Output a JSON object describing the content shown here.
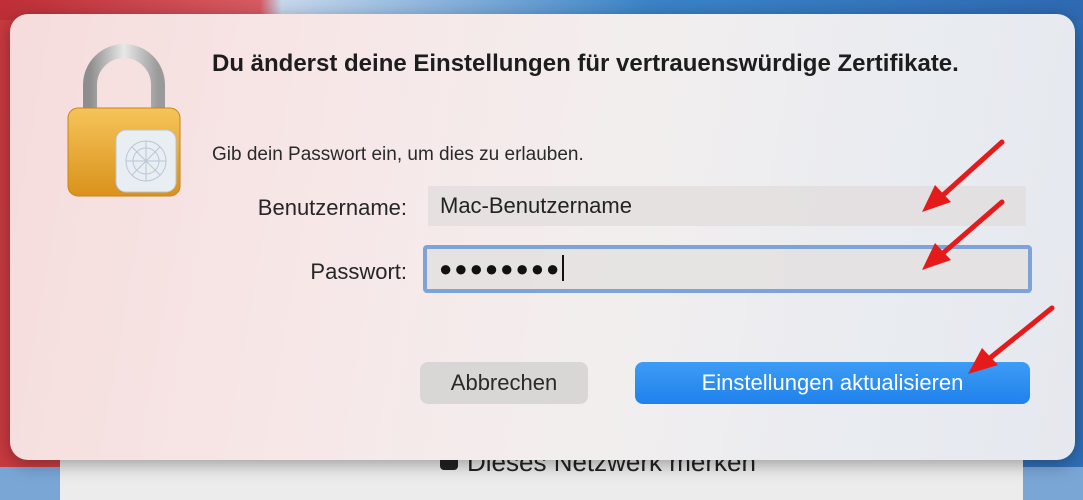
{
  "dialog": {
    "title": "Du änderst deine Einstellungen für vertrauenswürdige Zertifikate.",
    "subtitle": "Gib dein Passwort ein, um dies zu erlauben.",
    "username_label": "Benutzername:",
    "username_value": "Mac-Benutzername",
    "password_label": "Passwort:",
    "password_masked": "●●●●●●●●",
    "cancel_label": "Abbrechen",
    "confirm_label": "Einstellungen aktualisieren",
    "icon": "lock-icon"
  },
  "background": {
    "checkbox_label": "Dieses Netzwerk merken"
  },
  "colors": {
    "primary_button": "#2288ee",
    "focus_ring": "#7ea3d9",
    "annotation_arrow": "#e51b1b"
  }
}
